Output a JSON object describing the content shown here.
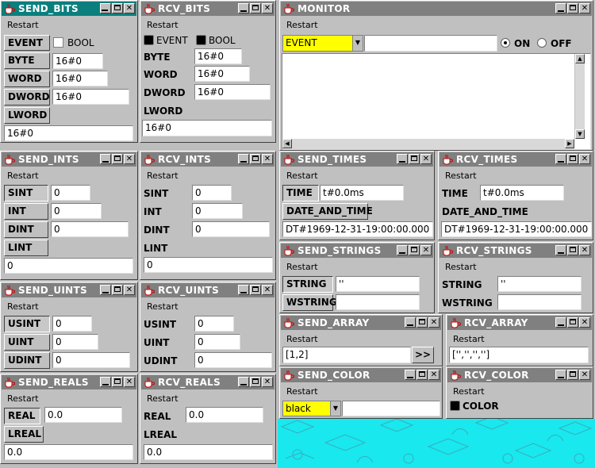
{
  "restart": "Restart",
  "send_bits": {
    "title": "SEND_BITS",
    "event": "EVENT",
    "bool": "BOOL",
    "byte": "BYTE",
    "word": "WORD",
    "dword": "DWORD",
    "lword": "LWORD",
    "byte_val": "16#0",
    "word_val": "16#0",
    "dword_val": "16#0",
    "lword_val": "16#0"
  },
  "rcv_bits": {
    "title": "RCV_BITS",
    "event": "EVENT",
    "bool": "BOOL",
    "byte": "BYTE",
    "word": "WORD",
    "dword": "DWORD",
    "lword": "LWORD",
    "byte_val": "16#0",
    "word_val": "16#0",
    "dword_val": "16#0",
    "lword_val": "16#0"
  },
  "monitor": {
    "title": "MONITOR",
    "select": "EVENT",
    "text": "",
    "on": "ON",
    "off": "OFF"
  },
  "send_ints": {
    "title": "SEND_INTS",
    "sint": "SINT",
    "int": "INT",
    "dint": "DINT",
    "lint": "LINT",
    "sint_val": "0",
    "int_val": "0",
    "dint_val": "0",
    "lint_val": "0"
  },
  "rcv_ints": {
    "title": "RCV_INTS",
    "sint": "SINT",
    "int": "INT",
    "dint": "DINT",
    "lint": "LINT",
    "sint_val": "0",
    "int_val": "0",
    "dint_val": "0",
    "lint_val": "0"
  },
  "send_times": {
    "title": "SEND_TIMES",
    "time": "TIME",
    "time_val": "t#0.0ms",
    "dt": "DATE_AND_TIME",
    "dt_val": "DT#1969-12-31-19:00:00.000"
  },
  "rcv_times": {
    "title": "RCV_TIMES",
    "time": "TIME",
    "time_val": "t#0.0ms",
    "dt": "DATE_AND_TIME",
    "dt_val": "DT#1969-12-31-19:00:00.000"
  },
  "send_uints": {
    "title": "SEND_UINTS",
    "usint": "USINT",
    "uint": "UINT",
    "udint": "UDINT",
    "usint_val": "0",
    "uint_val": "0",
    "udint_val": "0"
  },
  "rcv_uints": {
    "title": "RCV_UINTS",
    "usint": "USINT",
    "uint": "UINT",
    "udint": "UDINT",
    "usint_val": "0",
    "uint_val": "0",
    "udint_val": "0"
  },
  "send_strings": {
    "title": "SEND_STRINGS",
    "string": "STRING",
    "wstring": "WSTRING",
    "string_val": "''",
    "wstring_val": ""
  },
  "rcv_strings": {
    "title": "RCV_STRINGS",
    "string": "STRING",
    "wstring": "WSTRING",
    "string_val": "''",
    "wstring_val": ""
  },
  "send_array": {
    "title": "SEND_ARRAY",
    "val": "[1,2]",
    "btn": ">>"
  },
  "rcv_array": {
    "title": "RCV_ARRAY",
    "val": "['','','','']"
  },
  "send_reals": {
    "title": "SEND_REALS",
    "real": "REAL",
    "lreal": "LREAL",
    "real_val": "0.0",
    "lreal_val": "0.0"
  },
  "rcv_reals": {
    "title": "RCV_REALS",
    "real": "REAL",
    "lreal": "LREAL",
    "real_val": "0.0",
    "lreal_val": "0.0"
  },
  "send_color": {
    "title": "SEND_COLOR",
    "select": "black"
  },
  "rcv_color": {
    "title": "RCV_COLOR",
    "color": "COLOR"
  },
  "colors": {
    "active_title": "#0b7f7d",
    "inactive_title": "#808080",
    "desktop": "#19e8ee",
    "highlight": "#ffff00"
  }
}
